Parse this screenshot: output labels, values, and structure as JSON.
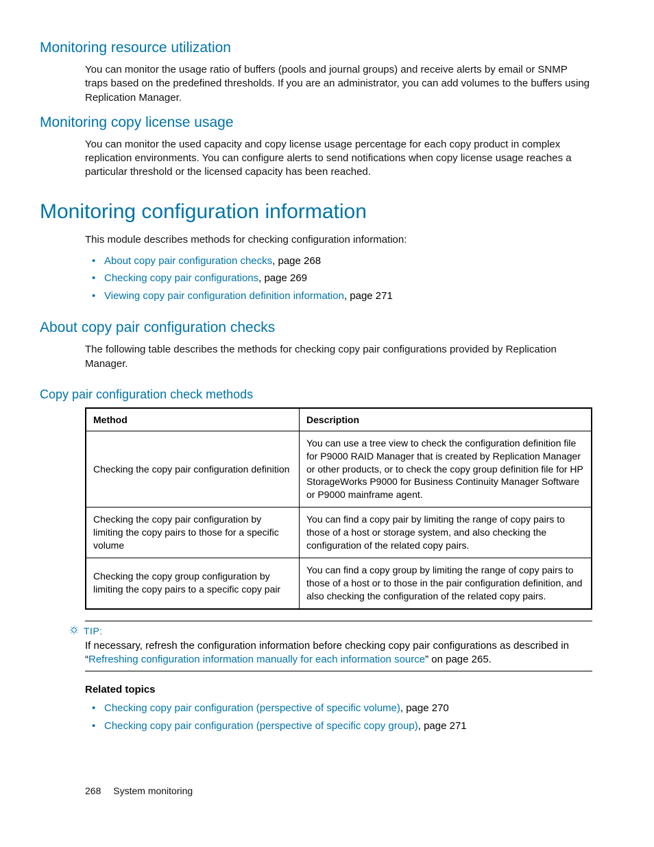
{
  "sections": {
    "s1": {
      "heading": "Monitoring resource utilization",
      "body": "You can monitor the usage ratio of buffers (pools and journal groups) and receive alerts by email or SNMP traps based on the predefined thresholds. If you are an administrator, you can add volumes to the buffers using Replication Manager."
    },
    "s2": {
      "heading": "Monitoring copy license usage",
      "body": "You can monitor the used capacity and copy license usage percentage for each copy product in complex replication environments. You can configure alerts to send notifications when copy license usage reaches a particular threshold or the licensed capacity has been reached."
    },
    "s3": {
      "heading": "Monitoring configuration information",
      "intro": "This module describes methods for checking configuration information:",
      "links": [
        {
          "text": "About copy pair configuration checks",
          "suffix": ", page 268"
        },
        {
          "text": "Checking copy pair configurations",
          "suffix": ", page 269"
        },
        {
          "text": "Viewing copy pair configuration definition information",
          "suffix": ", page 271"
        }
      ]
    },
    "s4": {
      "heading": "About copy pair configuration checks",
      "body": "The following table describes the methods for checking copy pair configurations provided by Replication Manager."
    },
    "s5": {
      "heading": "Copy pair configuration check methods"
    }
  },
  "table": {
    "headers": {
      "c1": "Method",
      "c2": "Description"
    },
    "rows": [
      {
        "method": "Checking the copy pair configuration definition",
        "desc": "You can use a tree view to check the configuration definition file for P9000 RAID Manager that is created by Replication Manager or other products, or to check the copy group definition file for HP StorageWorks P9000 for Business Continuity Manager Software or P9000 mainframe agent."
      },
      {
        "method": "Checking the copy pair configuration by limiting the copy pairs to those for a specific volume",
        "desc": "You can find a copy pair by limiting the range of copy pairs to those of a host or storage system, and also checking the configuration of the related copy pairs."
      },
      {
        "method": "Checking the copy group configuration by limiting the copy pairs to a specific copy pair",
        "desc": "You can find a copy group by limiting the range of copy pairs to those of a host or to those in the pair configuration definition, and also checking the configuration of the related copy pairs."
      }
    ]
  },
  "tip": {
    "label": "TIP:",
    "text_pre": "If necessary, refresh the configuration information before checking copy pair configurations as described in “",
    "link": "Refreshing configuration information manually for each information source",
    "text_post": "” on page 265."
  },
  "related": {
    "heading": "Related topics",
    "links": [
      {
        "text": "Checking copy pair configuration (perspective of specific volume)",
        "suffix": ", page 270"
      },
      {
        "text": "Checking copy pair configuration (perspective of specific copy group)",
        "suffix": ", page 271"
      }
    ]
  },
  "footer": {
    "page": "268",
    "section": "System monitoring"
  }
}
